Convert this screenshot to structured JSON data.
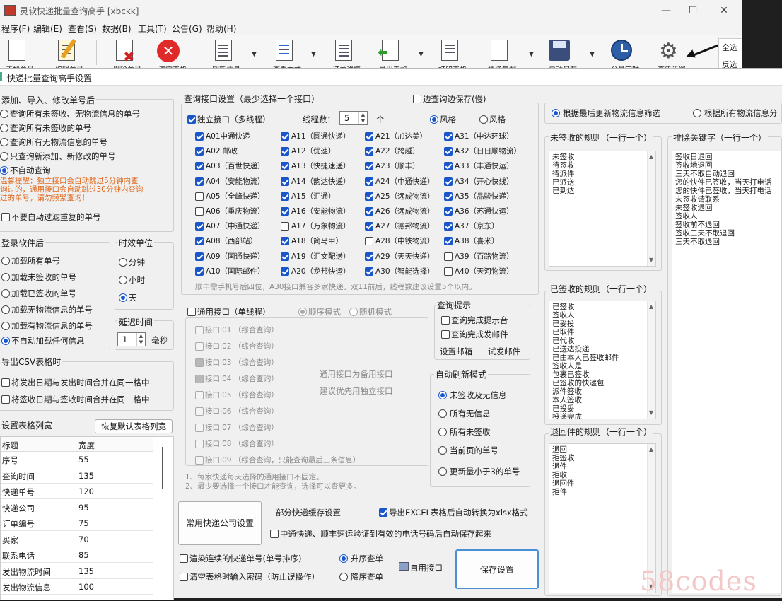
{
  "main": {
    "title": "灵软快递批量查询高手 [xbckk]",
    "menu": [
      "程序(F)",
      "编辑(E)",
      "查看(S)",
      "数据(B)",
      "工具(T)",
      "公告(G)",
      "帮助(H)"
    ],
    "toolbar": [
      {
        "label": "添加单号",
        "icon": "add-document-icon"
      },
      {
        "label": "编辑单号",
        "icon": "pencil-icon"
      },
      {
        "label": "删除单号",
        "icon": "delete-document-icon"
      },
      {
        "label": "清空表格",
        "icon": "clear-icon"
      },
      {
        "label": "刷新信息",
        "icon": "refresh-document-icon"
      },
      {
        "label": "查看方式",
        "icon": "view-icon"
      },
      {
        "label": "订单详情",
        "icon": "detail-icon"
      },
      {
        "label": "导出表格",
        "icon": "export-icon"
      },
      {
        "label": "打印表格",
        "icon": "print-icon"
      },
      {
        "label": "快递复制",
        "icon": "copy-icon"
      },
      {
        "label": "自动保存",
        "icon": "save-icon"
      },
      {
        "label": "分量定时",
        "icon": "timer-icon"
      },
      {
        "label": "高级设置",
        "icon": "gear-icon"
      }
    ],
    "right_panel": [
      "全选",
      "反选"
    ]
  },
  "dialog": {
    "title": "快递批量查询高手设置",
    "add_group": {
      "title": "添加、导入、修改单号后",
      "options": [
        "查询所有未签收、无物流信息的单号",
        "查询所有未签收的单号",
        "查询所有无物流信息的单号",
        "只查询新添加、新修改的单号",
        "不自动查询"
      ],
      "selected": 4,
      "warning": [
        "温馨提醒：独立接口会自动跳过5分钟内查",
        "询过的，通用接口会自动跳过30分钟内查询",
        "过的单号，请勿频繁查询！"
      ],
      "skip_label": "不要自动过滤重复的单号"
    },
    "login_group": {
      "title": "登录软件后",
      "options": [
        "加载所有单号",
        "加载未签收的单号",
        "加载已签收的单号",
        "加载无物流信息的单号",
        "加载有物流信息的单号",
        "不自动加载任何信息"
      ],
      "selected": 5
    },
    "time_unit": {
      "title": "时效单位",
      "options": [
        "分钟",
        "小时",
        "天"
      ],
      "selected": 2
    },
    "delay": {
      "title": "延迟时间",
      "value": "1",
      "unit": "毫秒"
    },
    "csv_group": {
      "title": "导出CSV表格时",
      "options": [
        "将发出日期与发出时间合并在同一格中",
        "将签收日期与签收时间合并在同一格中"
      ]
    },
    "columns_group": {
      "title": "设置表格列宽",
      "reset_button": "恢复默认表格列宽",
      "headers": [
        "标题",
        "宽度"
      ],
      "rows": [
        [
          "序号",
          "55"
        ],
        [
          "查询时间",
          "135"
        ],
        [
          "快递单号",
          "120"
        ],
        [
          "快递公司",
          "95"
        ],
        [
          "订单编号",
          "75"
        ],
        [
          "买家",
          "70"
        ],
        [
          "联系电话",
          "85"
        ],
        [
          "发出物流时间",
          "135"
        ],
        [
          "发出物流信息",
          "100"
        ]
      ]
    },
    "query_group": {
      "title": "查询接口设置（最少选择一个接口）",
      "edit_save": "边查询边保存(慢)",
      "independent": "独立接口（多线程）",
      "threads_label": "线程数：",
      "threads_value": "5",
      "threads_unit": "个",
      "style1": "风格一",
      "style2": "风格二",
      "interfaces": [
        {
          "label": "A01中通快递",
          "on": true
        },
        {
          "label": "A11（圆通快递）",
          "on": true
        },
        {
          "label": "A21（加达美）",
          "on": true
        },
        {
          "label": "A31（中达环球）",
          "on": true
        },
        {
          "label": "A02 邮政",
          "on": true
        },
        {
          "label": "A12（优速）",
          "on": true
        },
        {
          "label": "A22（跨越）",
          "on": true
        },
        {
          "label": "A32（日日顺物流）",
          "on": true
        },
        {
          "label": "A03（百世快递）",
          "on": true
        },
        {
          "label": "A13（快捷速递）",
          "on": true
        },
        {
          "label": "A23（顺丰）",
          "on": true
        },
        {
          "label": "A33（丰通快运）",
          "on": true
        },
        {
          "label": "A04（安能物流）",
          "on": true
        },
        {
          "label": "A14（韵达快递）",
          "on": true
        },
        {
          "label": "A24（中通快递）",
          "on": true
        },
        {
          "label": "A34（开心快线）",
          "on": true
        },
        {
          "label": "A05（全峰快递）",
          "on": false
        },
        {
          "label": "A15（汇通）",
          "on": true
        },
        {
          "label": "A25（远成物流）",
          "on": true
        },
        {
          "label": "A35（品骏快递）",
          "on": true
        },
        {
          "label": "A06（重庆物流）",
          "on": false
        },
        {
          "label": "A16（安能物流）",
          "on": true
        },
        {
          "label": "A26（远成物流）",
          "on": true
        },
        {
          "label": "A36（苏通快运）",
          "on": true
        },
        {
          "label": "A07（中通快递）",
          "on": true
        },
        {
          "label": "A17（万象物流）",
          "on": false
        },
        {
          "label": "A27（德邦物流）",
          "on": true
        },
        {
          "label": "A37（京东）",
          "on": true
        },
        {
          "label": "A08（西部站）",
          "on": true
        },
        {
          "label": "A18（简马甲）",
          "on": true
        },
        {
          "label": "A28（中铁物流）",
          "on": false
        },
        {
          "label": "A38（喜米）",
          "on": true
        },
        {
          "label": "A09（国通快递）",
          "on": true
        },
        {
          "label": "A19（汇文配送）",
          "on": true
        },
        {
          "label": "A29（天天快递）",
          "on": true
        },
        {
          "label": "A39（百路物流）",
          "on": false
        },
        {
          "label": "A10（国际邮件）",
          "on": true
        },
        {
          "label": "A20（龙邦快运）",
          "on": true
        },
        {
          "label": "A30（智能选择）",
          "on": true
        },
        {
          "label": "A40（天河物流）",
          "on": false
        }
      ],
      "note": "顺丰需手机号后四位，A30接口兼容多家快递。双11前后，线程数建议设置5个以内。"
    },
    "general_group": {
      "general": "通用接口（单线程）",
      "mode1": "顺序模式",
      "mode2": "随机模式",
      "interfaces": [
        {
          "label": "接口I01 （综合查询）",
          "on": false
        },
        {
          "label": "接口I02 （综合查询）",
          "on": false
        },
        {
          "label": "接口I03 （综合查询）",
          "on": true
        },
        {
          "label": "接口I04 （综合查询）",
          "on": true
        },
        {
          "label": "接口I05 （综合查询）",
          "on": false
        },
        {
          "label": "接口I06 （综合查询）",
          "on": false
        },
        {
          "label": "接口I07 （综合查询）",
          "on": false
        },
        {
          "label": "接口I08 （综合查询）",
          "on": false
        },
        {
          "label": "接口I09 （综合查询，只能查询最后三条信息）",
          "on": false
        }
      ],
      "hint": [
        "通用接口为备用接口",
        "建议优先用独立接口"
      ],
      "notes": [
        "1、每家快递每天选择的通用接口不固定。",
        "2、最少要选择一个接口才能查询，选择可以查更多。"
      ]
    },
    "prompt_group": {
      "title": "查询提示",
      "options": [
        "查询完成提示音",
        "查询完成发邮件"
      ],
      "mail_settings": "设置邮箱",
      "test_mail": "试发邮件"
    },
    "refresh_group": {
      "title": "自动刷新模式",
      "options": [
        "未签收及无信息",
        "所有无信息",
        "所有未签收",
        "当前页的单号",
        "更新量小于3的单号"
      ],
      "selected": 0
    },
    "bottom": {
      "common_express": "常用快递公司设置",
      "cache_label": "部分快递缓存设置",
      "export_excel": "导出EXCEL表格后自动转换为xlsx格式",
      "save_phone": "中通快递、顺丰速运验证到有效的电话号码后自动保存起来",
      "render_label": "渲染连续的快递单号(单号排序)",
      "asc": "升序查单",
      "desc": "降序查单",
      "auto_iface": "自用接口",
      "password_label": "清空表格时输入密码（防止误操作）",
      "save_button": "保存设置"
    },
    "filter": {
      "opt1": "根据最后更新物流信息筛选",
      "opt2": "根据所有物流信息分",
      "unsigned_title": "未签收的规则（一行一个）",
      "unsigned_rules": [
        "未签收",
        "待签收",
        "待派件",
        "已派送",
        "已到达"
      ],
      "signed_title": "已签收的规则（一行一个）",
      "signed_rules": [
        "已签收",
        "签收人",
        "已妥投",
        "已取件",
        "已代收",
        "已送达投递",
        "已由本人已签收邮件",
        "签收人是",
        "包裹已签收",
        "已签收的快递包",
        "派件签收",
        "本人签收",
        "已投妥",
        "投递完成"
      ],
      "returned_title": "退回件的规则（一行一个）",
      "returned_rules": [
        "退回",
        "拒签收",
        "退件",
        "拒收",
        "退回件",
        "拒件"
      ],
      "exclude_title": "排除关键字（一行一个）",
      "exclude_rules": [
        "签收日退回",
        "签收地退回",
        "三天不取自动退回",
        "您的快件已签收，当天打电话",
        "您的快件已签收，当天打电话",
        "未签收请联系",
        "未签收退回",
        "签收人",
        "签收前不退回",
        "签收三天不取退回",
        "三天不取退回"
      ]
    }
  },
  "watermark": "58codes"
}
